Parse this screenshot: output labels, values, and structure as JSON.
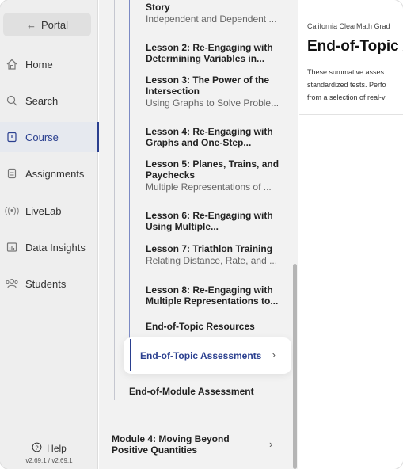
{
  "nav": {
    "portal_label": "Portal",
    "items": [
      {
        "label": "Home",
        "icon": "home-icon"
      },
      {
        "label": "Search",
        "icon": "search-icon"
      },
      {
        "label": "Course",
        "icon": "course-icon",
        "active": true
      },
      {
        "label": "Assignments",
        "icon": "assignments-icon"
      },
      {
        "label": "LiveLab",
        "icon": "livelab-icon"
      },
      {
        "label": "Data Insights",
        "icon": "data-insights-icon"
      },
      {
        "label": "Students",
        "icon": "students-icon"
      }
    ],
    "help_label": "Help",
    "version": "v2.69.1 / v2.69.1"
  },
  "tree": {
    "lessons": [
      {
        "title": "Story",
        "subtitle": "Independent and Dependent ..."
      },
      {
        "title": "Lesson 2: Re-Engaging with Determining Variables in...",
        "subtitle": ""
      },
      {
        "title": "Lesson 3: The Power of the Intersection",
        "subtitle": "Using Graphs to Solve Proble..."
      },
      {
        "title": "Lesson 4: Re-Engaging with Graphs and One-Step...",
        "subtitle": ""
      },
      {
        "title": "Lesson 5: Planes, Trains, and Paychecks",
        "subtitle": "Multiple Representations of ..."
      },
      {
        "title": "Lesson 6: Re-Engaging with Using Multiple...",
        "subtitle": ""
      },
      {
        "title": "Lesson 7: Triathlon Training",
        "subtitle": "Relating Distance, Rate, and ..."
      },
      {
        "title": "Lesson 8: Re-Engaging with Multiple Representations to...",
        "subtitle": ""
      }
    ],
    "end_of_topic_resources": "End-of-Topic Resources",
    "end_of_topic_assessments": "End-of-Topic Assessments",
    "end_of_module_assessment": "End-of-Module Assessment",
    "module4": "Module 4: Moving Beyond Positive Quantities"
  },
  "content": {
    "breadcrumb": "California ClearMath Grad",
    "title": "End-of-Topic A",
    "description_lines": [
      "These summative asses",
      "standardized tests. Perfo",
      "from a selection of real-v"
    ]
  },
  "colors": {
    "accent": "#2a3f8f",
    "nav_bg": "#eeeeee",
    "tree_bg": "#f2f2f2"
  }
}
